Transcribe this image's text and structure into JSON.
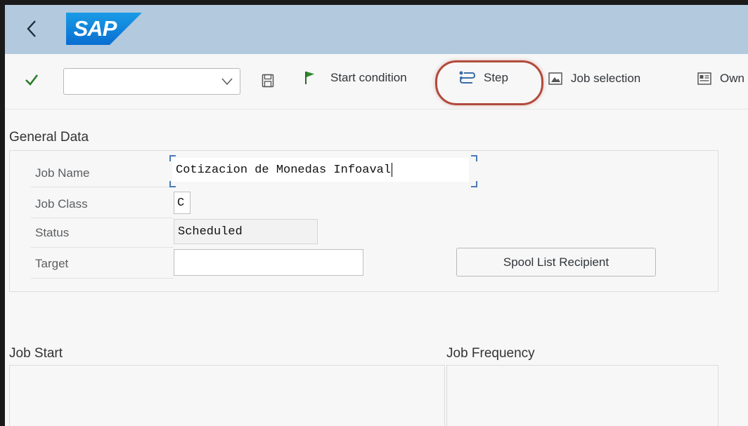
{
  "header": {
    "logo_text": "SAP",
    "brand_color": "#0a6ed1"
  },
  "toolbar": {
    "combo_value": "",
    "start_condition_label": "Start condition",
    "step_label": "Step",
    "job_selection_label": "Job selection",
    "own_label": "Own"
  },
  "general_data": {
    "title": "General Data",
    "job_name_label": "Job Name",
    "job_name_value": "Cotizacion de Monedas Infoaval",
    "job_class_label": "Job Class",
    "job_class_value": "C",
    "status_label": "Status",
    "status_value": "Scheduled",
    "target_label": "Target",
    "target_value": "",
    "spool_button_label": "Spool List Recipient"
  },
  "job_start": {
    "title": "Job Start"
  },
  "job_frequency": {
    "title": "Job Frequency"
  },
  "colors": {
    "shell_bar": "#b3c9de",
    "highlight_ring": "#b14a3c",
    "check_green": "#2b7d2b"
  }
}
